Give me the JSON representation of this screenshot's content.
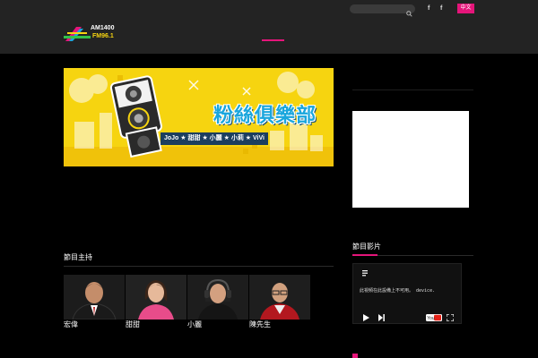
{
  "header": {
    "logo_text_top": "AM1400",
    "logo_text_bottom": "FM96.1",
    "search_placeholder": "",
    "social": [
      "f",
      "f"
    ],
    "lang_button": "中文"
  },
  "banner": {
    "title": "粉絲俱樂部",
    "subtitle": "JoJo ★ 甜甜 ★ 小麗 ★ 小莉 ★ ViVi"
  },
  "sections": {
    "hosts_title": "節目主持",
    "video_title": "節目影片"
  },
  "hosts": [
    {
      "name": "宏偉"
    },
    {
      "name": "甜甜"
    },
    {
      "name": "小麗"
    },
    {
      "name": "陳先生"
    }
  ],
  "video": {
    "message": "此視頻在此設備上不可用。 device."
  },
  "colors": {
    "accent": "#e5157a",
    "header_bg": "#232323",
    "banner_bg": "#f6d410"
  }
}
